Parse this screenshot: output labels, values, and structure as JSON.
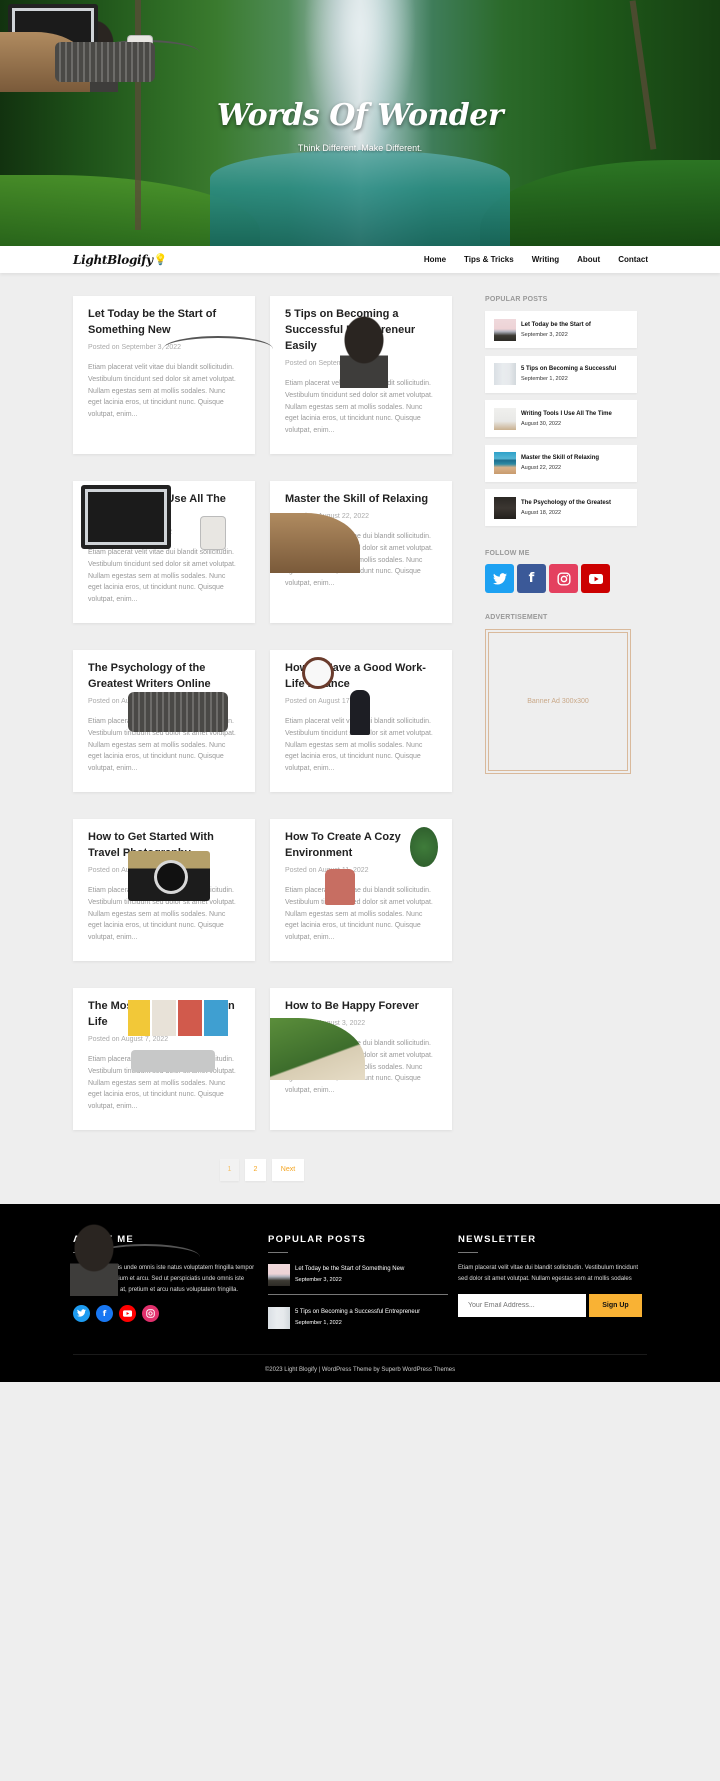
{
  "hero": {
    "title": "Words Of Wonder",
    "tagline": "Think Different. Make Different."
  },
  "nav": {
    "logo": "LightBlogify",
    "logo_icon": "lightbulb-icon",
    "items": [
      {
        "label": "Home"
      },
      {
        "label": "Tips & Tricks"
      },
      {
        "label": "Writing"
      },
      {
        "label": "About"
      },
      {
        "label": "Contact"
      }
    ]
  },
  "posts": [
    {
      "title": "Let Today be the Start of Something New",
      "date": "Posted on September 3, 2022",
      "image": "city-harbor-sunset",
      "excerpt": "Etiam placerat velit vitae dui blandit sollicitudin. Vestibulum tincidunt sed dolor sit amet volutpat. Nullam egestas sem at mollis sodales. Nunc eget lacinia eros, ut tincidunt nunc. Quisque volutpat, enim..."
    },
    {
      "title": "5 Tips on Becoming a Successful Entrepreneur Easily",
      "date": "Posted on September 1, 2022",
      "image": "man-facing-whiteboard",
      "excerpt": "Etiam placerat velit vitae dui blandit sollicitudin. Vestibulum tincidunt sed dolor sit amet volutpat. Nullam egestas sem at mollis sodales. Nunc eget lacinia eros, ut tincidunt nunc. Quisque volutpat, enim..."
    },
    {
      "title": "Writing Tools I Use All The Time",
      "date": "Posted on August 30, 2022",
      "image": "laptop-and-mug",
      "excerpt": "Etiam placerat velit vitae dui blandit sollicitudin. Vestibulum tincidunt sed dolor sit amet volutpat. Nullam egestas sem at mollis sodales. Nunc eget lacinia eros, ut tincidunt nunc. Quisque volutpat, enim..."
    },
    {
      "title": "Master the Skill of Relaxing",
      "date": "Posted on August 22, 2022",
      "image": "beach-cliffs",
      "excerpt": "Etiam placerat velit vitae dui blandit sollicitudin. Vestibulum tincidunt sed dolor sit amet volutpat. Nullam egestas sem at mollis sodales. Nunc eget lacinia eros, ut tincidunt nunc. Quisque volutpat, enim..."
    },
    {
      "title": "The Psychology of the Greatest Writers Online",
      "date": "Posted on August 18, 2022",
      "image": "typewriter",
      "excerpt": "Etiam placerat velit vitae dui blandit sollicitudin. Vestibulum tincidunt sed dolor sit amet volutpat. Nullam egestas sem at mollis sodales. Nunc eget lacinia eros, ut tincidunt nunc. Quisque volutpat, enim..."
    },
    {
      "title": "How to Have a Good Work-Life Balance",
      "date": "Posted on August 17, 2022",
      "image": "woman-at-cafe-counter",
      "excerpt": "Etiam placerat velit vitae dui blandit sollicitudin. Vestibulum tincidunt sed dolor sit amet volutpat. Nullam egestas sem at mollis sodales. Nunc eget lacinia eros, ut tincidunt nunc. Quisque volutpat, enim..."
    },
    {
      "title": "How to Get Started With Travel Photography",
      "date": "Posted on August 12, 2022",
      "image": "camera-flatlay",
      "excerpt": "Etiam placerat velit vitae dui blandit sollicitudin. Vestibulum tincidunt sed dolor sit amet volutpat. Nullam egestas sem at mollis sodales. Nunc eget lacinia eros, ut tincidunt nunc. Quisque volutpat, enim..."
    },
    {
      "title": "How To Create A Cozy Environment",
      "date": "Posted on August 11, 2022",
      "image": "cozy-living-room",
      "excerpt": "Etiam placerat velit vitae dui blandit sollicitudin. Vestibulum tincidunt sed dolor sit amet volutpat. Nullam egestas sem at mollis sodales. Nunc eget lacinia eros, ut tincidunt nunc. Quisque volutpat, enim..."
    },
    {
      "title": "The Most Important Skills In Life",
      "date": "Posted on August 7, 2022",
      "image": "desk-with-prints",
      "excerpt": "Etiam placerat velit vitae dui blandit sollicitudin. Vestibulum tincidunt sed dolor sit amet volutpat. Nullam egestas sem at mollis sodales. Nunc eget lacinia eros, ut tincidunt nunc. Quisque volutpat, enim..."
    },
    {
      "title": "How to Be Happy Forever",
      "date": "Posted on August 3, 2022",
      "image": "coastal-cliffs",
      "excerpt": "Etiam placerat velit vitae dui blandit sollicitudin. Vestibulum tincidunt sed dolor sit amet volutpat. Nullam egestas sem at mollis sodales. Nunc eget lacinia eros, ut tincidunt nunc. Quisque volutpat, enim..."
    }
  ],
  "sidebar": {
    "popular_title": "POPULAR POSTS",
    "popular": [
      {
        "title": "Let Today be the Start of",
        "date": "September 3, 2022"
      },
      {
        "title": "5 Tips on Becoming a Successful",
        "date": "September 1, 2022"
      },
      {
        "title": "Writing Tools I Use All The Time",
        "date": "August 30, 2022"
      },
      {
        "title": "Master the Skill of Relaxing",
        "date": "August 22, 2022"
      },
      {
        "title": "The Psychology of the Greatest",
        "date": "August 18, 2022"
      }
    ],
    "follow_title": "FOLLOW ME",
    "social": [
      {
        "name": "twitter",
        "glyph": "🐦",
        "color": "#1da1f2"
      },
      {
        "name": "facebook",
        "glyph": "f",
        "color": "#3b5998"
      },
      {
        "name": "instagram",
        "glyph": "◎",
        "color": "#e4405f"
      },
      {
        "name": "youtube",
        "glyph": "▶",
        "color": "#cc0000"
      }
    ],
    "ad_title": "ADVERTISEMENT",
    "ad_text": "Banner Ad 300x300"
  },
  "pagination": {
    "pages": [
      "1",
      "2"
    ],
    "current": "1",
    "next_label": "Next"
  },
  "footer": {
    "about_title": "ABOUT ME",
    "about_text": "Sed ut perspiciatis unde omnis iste natus voluptatem fringilla tempor dignissim at, pretium et arcu. Sed ut perspiciatis unde omnis iste tempor dignissim at, pretium et arcu natus voluptatem fringilla.",
    "about_social": [
      {
        "name": "twitter",
        "glyph": "t",
        "color": "#1d9bf0"
      },
      {
        "name": "facebook",
        "glyph": "f",
        "color": "#1877f2"
      },
      {
        "name": "youtube",
        "glyph": "▶",
        "color": "#ff0000"
      },
      {
        "name": "instagram",
        "glyph": "◎",
        "color": "#e1306c"
      }
    ],
    "popular_title": "POPULAR POSTS",
    "popular": [
      {
        "title": "Let Today be the Start of Something New",
        "date": "September 3, 2022"
      },
      {
        "title": "5 Tips on Becoming a Successful Entrepreneur",
        "date": "September 1, 2022"
      }
    ],
    "newsletter_title": "NEWSLETTER",
    "newsletter_text": "Etiam placerat velit vitae dui blandit sollicitudin. Vestibulum tincidunt sed dolor sit amet volutpat. Nullam egestas sem at mollis sodales",
    "email_placeholder": "Your Email Address...",
    "signup_label": "Sign Up",
    "copyright": "©2023 Light Blogify | WordPress Theme by Superb WordPress Themes"
  },
  "colors": {
    "accent": "#f9b234",
    "pagination_text": "#f5a623",
    "ad_border": "#d9b99b",
    "footer_bg": "#000000",
    "page_bg": "#eeeeee"
  }
}
